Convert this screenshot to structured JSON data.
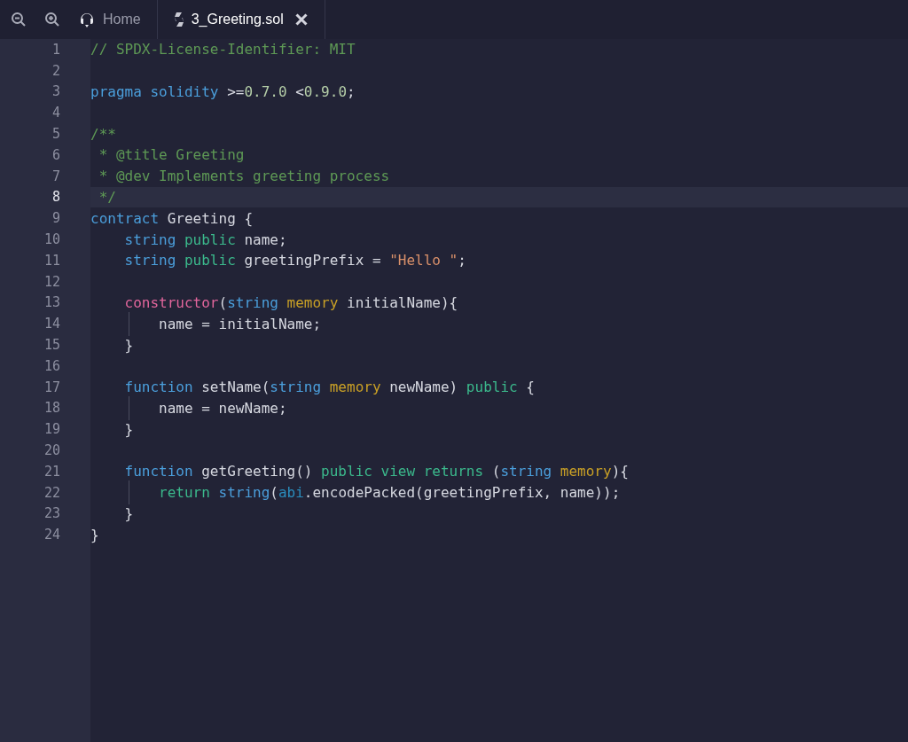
{
  "tabs": [
    {
      "label": "Home",
      "kind": "home",
      "selected": false,
      "closable": false
    },
    {
      "label": "3_Greeting.sol",
      "kind": "solidity",
      "selected": true,
      "closable": true
    }
  ],
  "editor": {
    "lines": [
      {
        "number": "1",
        "active": false,
        "tokens": [
          {
            "kind": "comment",
            "text": "// SPDX-License-Identifier: MIT"
          }
        ]
      },
      {
        "number": "2",
        "active": false
      },
      {
        "number": "3",
        "active": false,
        "tokens": [
          {
            "kind": "keyword",
            "text": "pragma solidity"
          },
          {
            "kind": "plain",
            "text": " >="
          },
          {
            "kind": "number",
            "text": "0.7.0"
          },
          {
            "kind": "plain",
            "text": " <"
          },
          {
            "kind": "number",
            "text": "0.9.0"
          },
          {
            "kind": "plain",
            "text": ";"
          }
        ]
      },
      {
        "number": "4",
        "active": false
      },
      {
        "number": "5",
        "active": false,
        "tokens": [
          {
            "kind": "comment",
            "text": "/**"
          }
        ]
      },
      {
        "number": "6",
        "active": false,
        "tokens": [
          {
            "kind": "comment",
            "text": " * @title Greeting"
          }
        ]
      },
      {
        "number": "7",
        "active": false,
        "tokens": [
          {
            "kind": "comment",
            "text": " * @dev Implements greeting process"
          }
        ]
      },
      {
        "number": "8",
        "active": true,
        "tokens": [
          {
            "kind": "comment",
            "text": " */"
          }
        ]
      },
      {
        "number": "9",
        "active": false,
        "tokens": [
          {
            "kind": "keyword",
            "text": "contract"
          },
          {
            "kind": "plain",
            "text": " Greeting {"
          }
        ]
      },
      {
        "number": "10",
        "active": false,
        "tokens": [
          {
            "kind": "keyword",
            "text": "    string"
          },
          {
            "kind": "modifier",
            "text": " public"
          },
          {
            "kind": "plain",
            "text": " name;"
          }
        ]
      },
      {
        "number": "11",
        "active": false,
        "tokens": [
          {
            "kind": "keyword",
            "text": "    string"
          },
          {
            "kind": "modifier",
            "text": " public"
          },
          {
            "kind": "plain",
            "text": " greetingPrefix = "
          },
          {
            "kind": "string",
            "text": "\"Hello \""
          },
          {
            "kind": "plain",
            "text": ";"
          }
        ]
      },
      {
        "number": "12",
        "active": false
      },
      {
        "number": "13",
        "active": false,
        "tokens": [
          {
            "kind": "special",
            "text": "    constructor"
          },
          {
            "kind": "plain",
            "text": "("
          },
          {
            "kind": "keyword",
            "text": "string"
          },
          {
            "kind": "storage",
            "text": " memory"
          },
          {
            "kind": "plain",
            "text": " initialName){"
          }
        ]
      },
      {
        "number": "14",
        "active": false,
        "tokens": [
          {
            "kind": "plain",
            "text": "        name = initialName;"
          }
        ]
      },
      {
        "number": "15",
        "active": false,
        "tokens": [
          {
            "kind": "plain",
            "text": "    }"
          }
        ]
      },
      {
        "number": "16",
        "active": false
      },
      {
        "number": "17",
        "active": false,
        "tokens": [
          {
            "kind": "keyword",
            "text": "    function"
          },
          {
            "kind": "plain",
            "text": " setName("
          },
          {
            "kind": "keyword",
            "text": "string"
          },
          {
            "kind": "storage",
            "text": " memory"
          },
          {
            "kind": "plain",
            "text": " newName) "
          },
          {
            "kind": "modifier",
            "text": "public"
          },
          {
            "kind": "plain",
            "text": " {"
          }
        ]
      },
      {
        "number": "18",
        "active": false,
        "tokens": [
          {
            "kind": "plain",
            "text": "        name = newName;"
          }
        ]
      },
      {
        "number": "19",
        "active": false,
        "tokens": [
          {
            "kind": "plain",
            "text": "    }"
          }
        ]
      },
      {
        "number": "20",
        "active": false
      },
      {
        "number": "21",
        "active": false,
        "tokens": [
          {
            "kind": "keyword",
            "text": "    function"
          },
          {
            "kind": "plain",
            "text": " getGreeting() "
          },
          {
            "kind": "modifier",
            "text": "public view returns"
          },
          {
            "kind": "plain",
            "text": " ("
          },
          {
            "kind": "keyword",
            "text": "string"
          },
          {
            "kind": "storage",
            "text": " memory"
          },
          {
            "kind": "plain",
            "text": "){"
          }
        ]
      },
      {
        "number": "22",
        "active": false,
        "tokens": [
          {
            "kind": "modifier",
            "text": "        return"
          },
          {
            "kind": "keyword",
            "text": " string"
          },
          {
            "kind": "plain",
            "text": "("
          },
          {
            "kind": "builtin",
            "text": "abi"
          },
          {
            "kind": "plain",
            "text": ".encodePacked(greetingPrefix, name));"
          }
        ]
      },
      {
        "number": "23",
        "active": false,
        "tokens": [
          {
            "kind": "plain",
            "text": "    }"
          }
        ]
      },
      {
        "number": "24",
        "active": false,
        "tokens": [
          {
            "kind": "plain",
            "text": "}"
          }
        ]
      }
    ]
  }
}
